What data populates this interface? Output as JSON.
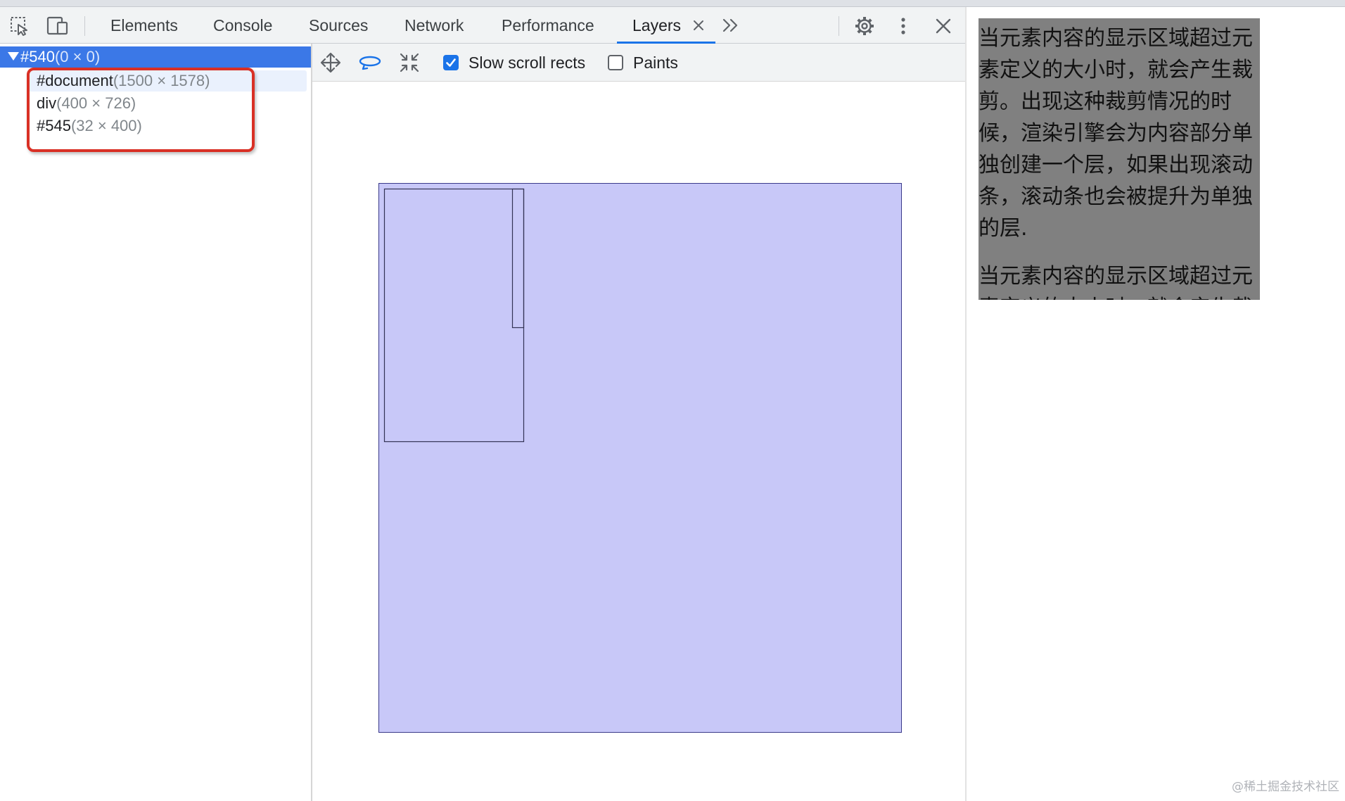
{
  "toolbar": {
    "tabs": [
      {
        "label": "Elements"
      },
      {
        "label": "Console"
      },
      {
        "label": "Sources"
      },
      {
        "label": "Network"
      },
      {
        "label": "Performance"
      },
      {
        "label": "Layers",
        "active": true
      }
    ],
    "more_tabs_label": "»",
    "icons": [
      "inspect-element-icon",
      "device-toolbar-icon",
      "close-tab-icon",
      "more-tabs-icon",
      "settings-gear-icon",
      "kebab-menu-icon",
      "close-devtools-icon"
    ]
  },
  "layer_tree": {
    "root": {
      "name": "#540",
      "size": "(0 × 0)"
    },
    "children": [
      {
        "name": "#document",
        "size": "(1500 × 1578)"
      },
      {
        "name": "div",
        "size": "(400 × 726)"
      },
      {
        "name": "#545",
        "size": "(32 × 400)"
      }
    ]
  },
  "layers_toolbar": {
    "icons": [
      "pan-mode-icon",
      "rotate-mode-icon",
      "reset-view-icon"
    ],
    "slow_scroll_rects": {
      "label": "Slow scroll rects",
      "checked": true
    },
    "paints": {
      "label": "Paints",
      "checked": false
    }
  },
  "preview": {
    "paragraph_1": "当元素内容的显示区域超过元素定义的大小时，就会产生裁剪。出现这种裁剪情况的时候，渲染引擎会为内容部分单独创建一个层，如果出现滚动条，滚动条也会被提升为单独的层.",
    "paragraph_2": "当元素内容的显示区域超过元素定义的大小时，就会产生裁剪。"
  },
  "watermark": "@稀土掘金技术社区",
  "colors": {
    "accent": "#1a73e8",
    "selected_row": "#3b78e7",
    "highlight_border": "#d93025",
    "layer_fill": "#c8c8f8",
    "preview_bg": "#808080"
  }
}
